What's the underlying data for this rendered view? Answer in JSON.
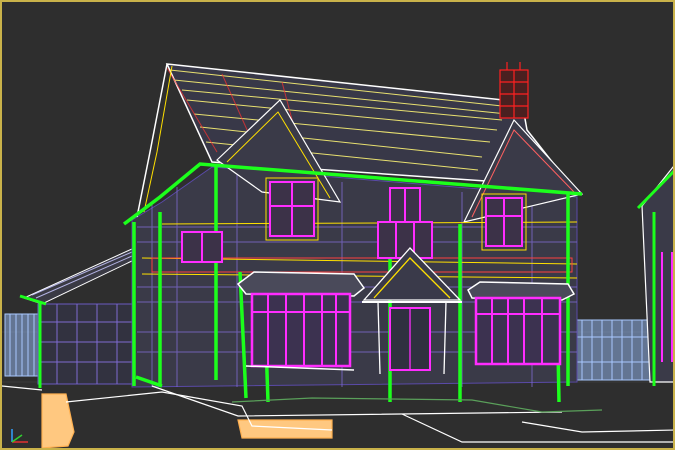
{
  "viewport": {
    "active": true,
    "render_mode": "wireframe",
    "background": "#2e2e2e",
    "border_color": "#c9b24a"
  },
  "colors": {
    "gutter": "#1cff1c",
    "window_frame": "#ff2cff",
    "roof_edges": "#ffffff",
    "roof_lines": "#e8e070",
    "fence": "#a8c8ff",
    "brick_hatch": "#7e6ad0",
    "chimney": "#ff2020",
    "ground_paths": "#ffc880",
    "ground_outline": "#ffffff",
    "trim_lines": "#ffe000"
  },
  "objects": [
    {
      "name": "house-main"
    },
    {
      "name": "garage-annex"
    },
    {
      "name": "chimney"
    },
    {
      "name": "porch-canopy"
    },
    {
      "name": "bay-window-left"
    },
    {
      "name": "bay-window-right"
    },
    {
      "name": "picket-fence"
    },
    {
      "name": "driveway"
    },
    {
      "name": "neighbour-house"
    }
  ],
  "axis_gizmo": {
    "icon": "xyz-axis-icon"
  }
}
